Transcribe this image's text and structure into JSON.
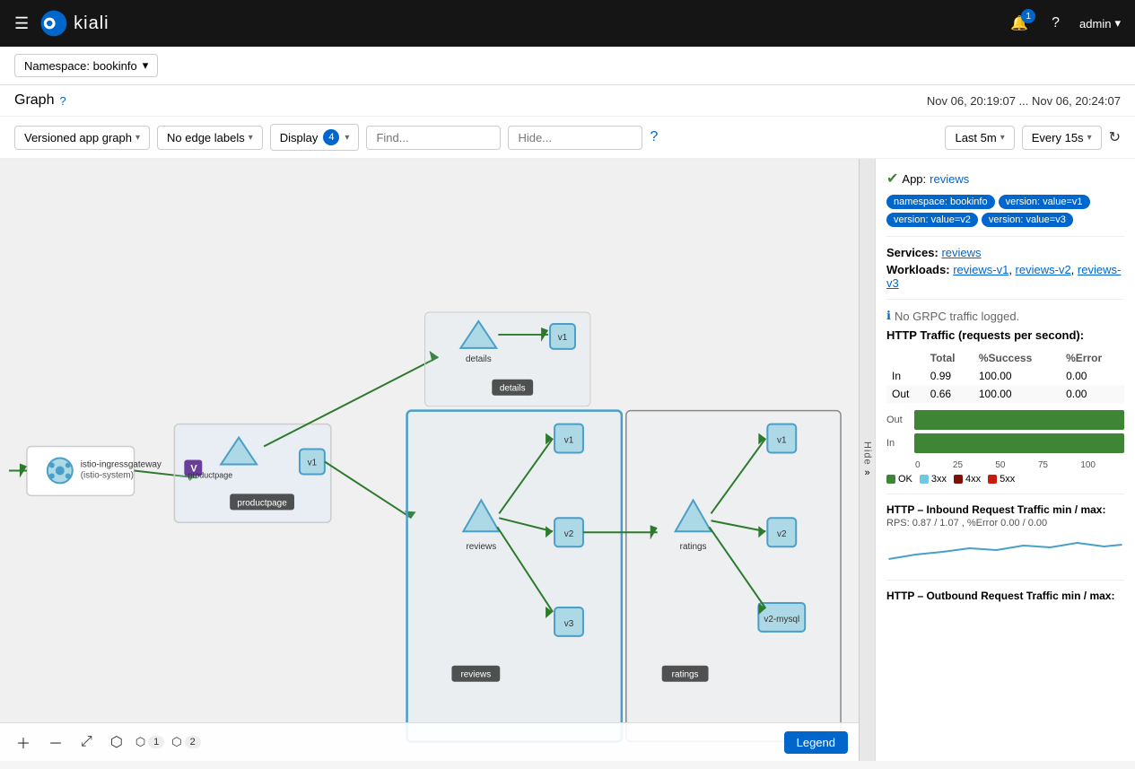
{
  "topnav": {
    "logo_text": "kiali",
    "bell_count": "1",
    "user": "admin",
    "caret": "▾"
  },
  "breadcrumb": {
    "namespace_label": "Namespace: bookinfo"
  },
  "graph_header": {
    "title": "Graph",
    "time_range": "Nov 06, 20:19:07 ... Nov 06, 20:24:07"
  },
  "toolbar": {
    "graph_type": "Versioned app graph",
    "edge_labels": "No edge labels",
    "display_label": "Display",
    "display_count": "4",
    "find_placeholder": "Find...",
    "hide_placeholder": "Hide...",
    "time_window": "Last 5m",
    "refresh_interval": "Every 15s"
  },
  "right_panel": {
    "status_icon": "✔",
    "app_label": "App:",
    "app_name": "reviews",
    "tags": [
      "namespace: bookinfo",
      "version: value=v1",
      "version: value=v2",
      "version: value=v3"
    ],
    "services_label": "Services:",
    "services": [
      "reviews"
    ],
    "workloads_label": "Workloads:",
    "workloads": [
      "reviews-v1",
      "reviews-v2",
      "reviews-v3"
    ],
    "grpc_note": "No GRPC traffic logged.",
    "http_traffic_label": "HTTP Traffic (requests per second):",
    "table": {
      "headers": [
        "",
        "Total",
        "%Success",
        "%Error"
      ],
      "rows": [
        [
          "In",
          "0.99",
          "100.00",
          "0.00"
        ],
        [
          "Out",
          "0.66",
          "100.00",
          "0.00"
        ]
      ]
    },
    "bar_chart": {
      "out_ok_pct": 100,
      "out_3xx_pct": 0,
      "out_4xx_pct": 0,
      "out_5xx_pct": 0,
      "in_ok_pct": 100,
      "in_3xx_pct": 0,
      "in_4xx_pct": 0,
      "in_5xx_pct": 0
    },
    "axis_labels": [
      "0",
      "25",
      "50",
      "75",
      "100"
    ],
    "legend": [
      {
        "color": "#3e8635",
        "label": "OK"
      },
      {
        "color": "#6ec9e0",
        "label": "3xx"
      },
      {
        "color": "#7d1007",
        "label": "4xx"
      },
      {
        "color": "#c9190b",
        "label": "5xx"
      }
    ],
    "inbound_title": "HTTP – Inbound Request Traffic min / max:",
    "inbound_subtitle": "RPS: 0.87 / 1.07 , %Error 0.00 / 0.00",
    "outbound_title": "HTTP – Outbound Request Traffic min / max:"
  },
  "graph_nodes": {
    "istio_gateway": "istio-ingressgateway\n(istio-system)",
    "productpage": "productpage",
    "v1_product": "v1",
    "details": "details",
    "details_v1": "v1",
    "reviews": "reviews",
    "reviews_v1": "v1",
    "reviews_v2": "v2",
    "reviews_v3": "v3",
    "ratings": "ratings",
    "ratings_v1": "v1",
    "ratings_v2": "v2",
    "ratings_v2mysql": "v2-mysql"
  },
  "bottom_toolbar": {
    "zoom_in": "+",
    "zoom_out": "−",
    "fit": "⤢",
    "node1_label": "1",
    "node2_label": "2",
    "legend_label": "Legend"
  },
  "hide_panel": {
    "label": "Hide"
  }
}
